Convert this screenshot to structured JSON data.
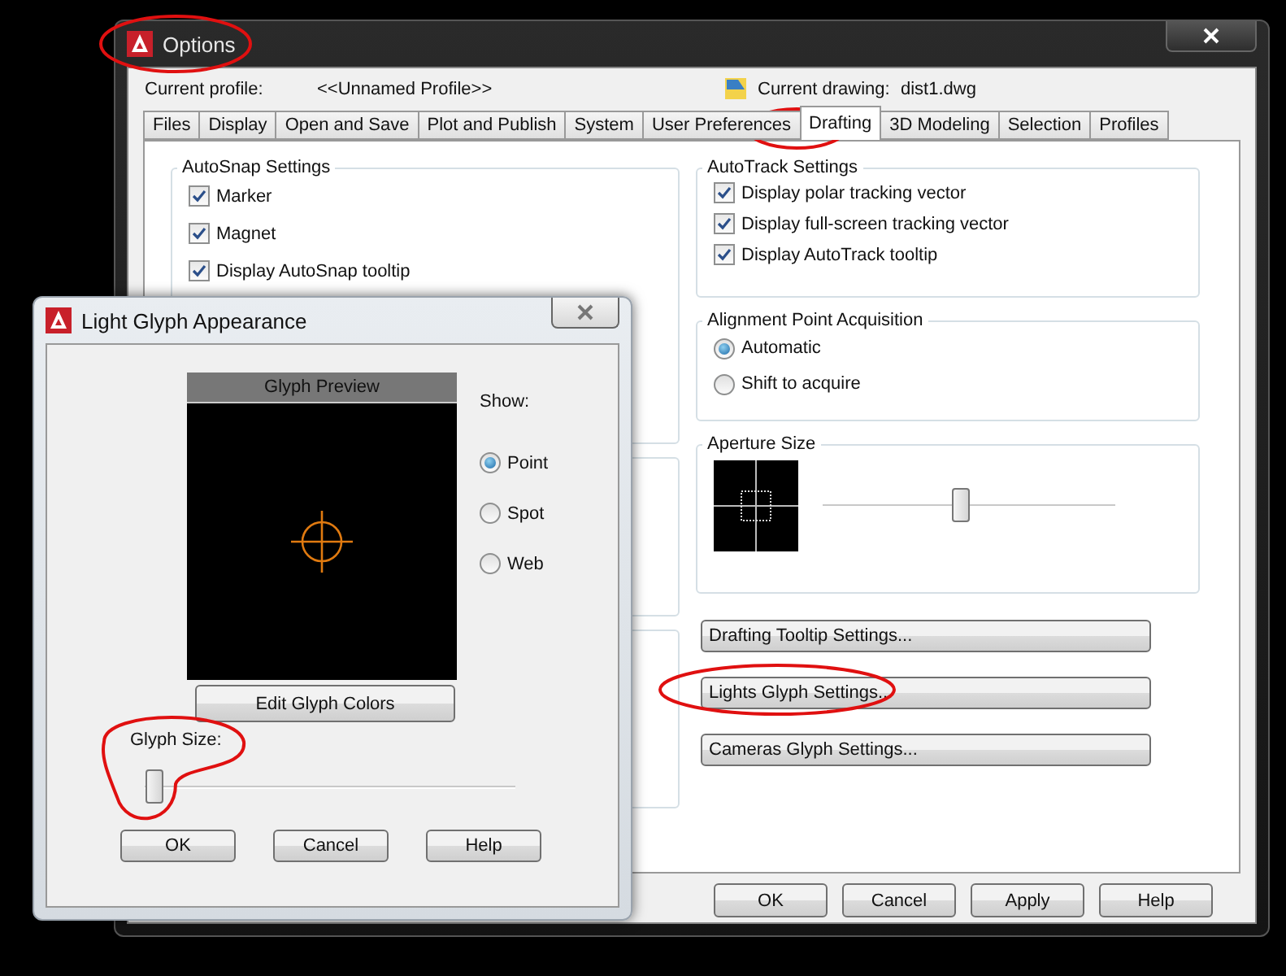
{
  "options_window": {
    "title": "Options",
    "profile_label": "Current profile:",
    "profile_value": "<<Unnamed Profile>>",
    "drawing_label": "Current drawing:",
    "drawing_value": "dist1.dwg",
    "tabs": [
      {
        "label": "Files",
        "selected": false
      },
      {
        "label": "Display",
        "selected": false
      },
      {
        "label": "Open and Save",
        "selected": false
      },
      {
        "label": "Plot and Publish",
        "selected": false
      },
      {
        "label": "System",
        "selected": false
      },
      {
        "label": "User Preferences",
        "selected": false
      },
      {
        "label": "Drafting",
        "selected": true
      },
      {
        "label": "3D Modeling",
        "selected": false
      },
      {
        "label": "Selection",
        "selected": false
      },
      {
        "label": "Profiles",
        "selected": false
      }
    ],
    "autosnap": {
      "title": "AutoSnap Settings",
      "options": [
        {
          "label": "Marker",
          "checked": true
        },
        {
          "label": "Magnet",
          "checked": true
        },
        {
          "label": "Display AutoSnap tooltip",
          "checked": true
        }
      ]
    },
    "autotrack": {
      "title": "AutoTrack Settings",
      "options": [
        {
          "label": "Display polar tracking vector",
          "checked": true
        },
        {
          "label": "Display full-screen tracking vector",
          "checked": true
        },
        {
          "label": "Display AutoTrack tooltip",
          "checked": true
        }
      ]
    },
    "alignment": {
      "title": "Alignment Point Acquisition",
      "options": [
        {
          "label": "Automatic",
          "selected": true
        },
        {
          "label": "Shift to acquire",
          "selected": false
        }
      ]
    },
    "aperture": {
      "title": "Aperture Size",
      "level": 0.47
    },
    "settings_buttons": [
      "Drafting Tooltip Settings...",
      "Lights Glyph Settings...",
      "Cameras Glyph Settings..."
    ],
    "buttons": [
      "OK",
      "Cancel",
      "Apply",
      "Help"
    ]
  },
  "glyph_dialog": {
    "title": "Light Glyph Appearance",
    "preview_title": "Glyph Preview",
    "show_label": "Show:",
    "show_options": [
      {
        "label": "Point",
        "selected": true
      },
      {
        "label": "Spot",
        "selected": false
      },
      {
        "label": "Web",
        "selected": false
      }
    ],
    "edit_button": "Edit Glyph Colors",
    "size_label": "Glyph Size:",
    "size": {
      "level": 0.0
    },
    "buttons": [
      "OK",
      "Cancel",
      "Help"
    ]
  }
}
